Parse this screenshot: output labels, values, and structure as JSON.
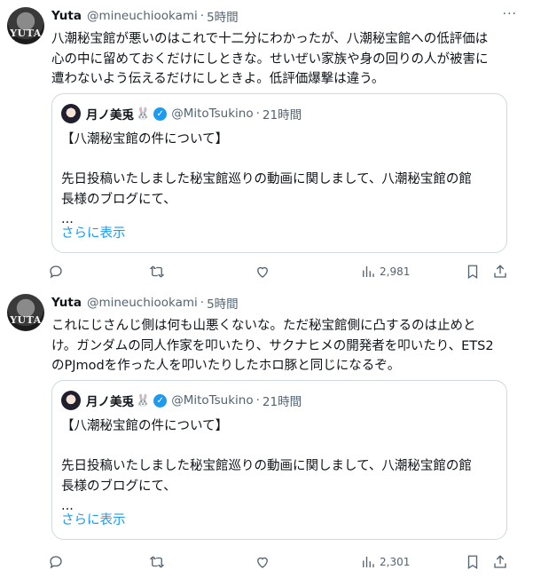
{
  "tweets": [
    {
      "avatar_text": "YUTA",
      "name": "Yuta",
      "handle": "@mineuchiookami",
      "separator": "·",
      "time": "5時間",
      "more_icon": "···",
      "lines": [
        "八潮秘宝館が悪いのはこれで十二分にわかったが、八潮秘宝館への低評価は",
        "心の中に留めておくだけにしときな。せいぜい家族や身の回りの人が被害に",
        "遭わないよう伝えるだけにしときよ。低評価爆撃は違う。"
      ],
      "quote": {
        "name": "月ノ美兎",
        "emoji": "🐰",
        "verified_icon": "✓",
        "handle": "@MitoTsukino",
        "separator": "·",
        "time": "21時間",
        "lines": [
          "【八潮秘宝館の件について】",
          "",
          "先日投稿いたしました秘宝館巡りの動画に関しまして、八潮秘宝館の館",
          "長様のブログにて、",
          "..."
        ],
        "show_more": "さらに表示"
      },
      "views": "2,981"
    },
    {
      "avatar_text": "YUTA",
      "name": "Yuta",
      "handle": "@mineuchiookami",
      "separator": "·",
      "time": "5時間",
      "lines": [
        "これにじさんじ側は何も山悪くないな。ただ秘宝館側に凸するのは止めと",
        "け。ガンダムの同人作家を叩いたり、サクナヒメの開発者を叩いたり、ETS2",
        "のPJmodを作った人を叩いたりしたホロ豚と同じになるぞ。"
      ],
      "quote": {
        "name": "月ノ美兎",
        "emoji": "🐰",
        "verified_icon": "✓",
        "handle": "@MitoTsukino",
        "separator": "·",
        "time": "21時間",
        "lines": [
          "【八潮秘宝館の件について】",
          "",
          "先日投稿いたしました秘宝館巡りの動画に関しまして、八潮秘宝館の館",
          "長様のブログにて、",
          "..."
        ],
        "show_more": "さらに表示"
      },
      "views": "2,301"
    }
  ],
  "icons": [
    "reply-icon",
    "retweet-icon",
    "like-icon",
    "views-icon",
    "bookmark-icon",
    "share-icon"
  ],
  "colors": {
    "text": "#0f1419",
    "secondary": "#536471",
    "link": "#1d9bf0",
    "border": "#cfd9de"
  }
}
